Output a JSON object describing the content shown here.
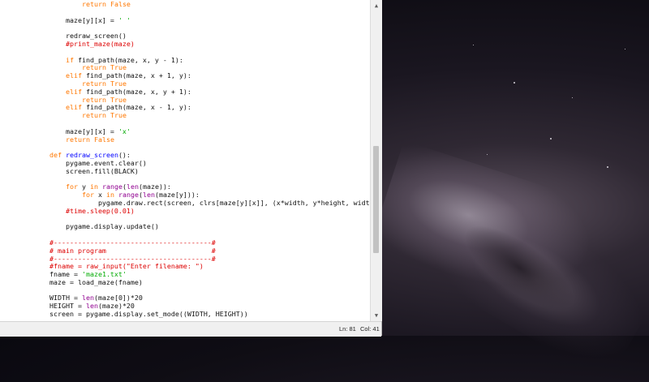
{
  "editor": {
    "lines": [
      [
        {
          "t": "        "
        },
        {
          "t": "return",
          "c": "kw"
        },
        {
          "t": " "
        },
        {
          "t": "False",
          "c": "kw"
        }
      ],
      [
        {
          "t": ""
        }
      ],
      [
        {
          "t": "    maze[y][x] = "
        },
        {
          "t": "' '",
          "c": "str"
        }
      ],
      [
        {
          "t": ""
        }
      ],
      [
        {
          "t": "    redraw_screen()"
        }
      ],
      [
        {
          "t": "    "
        },
        {
          "t": "#print_maze(maze)",
          "c": "cmt"
        }
      ],
      [
        {
          "t": ""
        }
      ],
      [
        {
          "t": "    "
        },
        {
          "t": "if",
          "c": "kw"
        },
        {
          "t": " find_path(maze, x, y - 1):"
        }
      ],
      [
        {
          "t": "        "
        },
        {
          "t": "return",
          "c": "kw"
        },
        {
          "t": " "
        },
        {
          "t": "True",
          "c": "kw"
        }
      ],
      [
        {
          "t": "    "
        },
        {
          "t": "elif",
          "c": "kw"
        },
        {
          "t": " find_path(maze, x + 1, y):"
        }
      ],
      [
        {
          "t": "        "
        },
        {
          "t": "return",
          "c": "kw"
        },
        {
          "t": " "
        },
        {
          "t": "True",
          "c": "kw"
        }
      ],
      [
        {
          "t": "    "
        },
        {
          "t": "elif",
          "c": "kw"
        },
        {
          "t": " find_path(maze, x, y + 1):"
        }
      ],
      [
        {
          "t": "        "
        },
        {
          "t": "return",
          "c": "kw"
        },
        {
          "t": " "
        },
        {
          "t": "True",
          "c": "kw"
        }
      ],
      [
        {
          "t": "    "
        },
        {
          "t": "elif",
          "c": "kw"
        },
        {
          "t": " find_path(maze, x - 1, y):"
        }
      ],
      [
        {
          "t": "        "
        },
        {
          "t": "return",
          "c": "kw"
        },
        {
          "t": " "
        },
        {
          "t": "True",
          "c": "kw"
        }
      ],
      [
        {
          "t": ""
        }
      ],
      [
        {
          "t": "    maze[y][x] = "
        },
        {
          "t": "'x'",
          "c": "str"
        }
      ],
      [
        {
          "t": "    "
        },
        {
          "t": "return",
          "c": "kw"
        },
        {
          "t": " "
        },
        {
          "t": "False",
          "c": "kw"
        }
      ],
      [
        {
          "t": ""
        }
      ],
      [
        {
          "t": "def",
          "c": "kw"
        },
        {
          "t": " "
        },
        {
          "t": "redraw_screen",
          "c": "def"
        },
        {
          "t": "():"
        }
      ],
      [
        {
          "t": "    pygame.event.clear()"
        }
      ],
      [
        {
          "t": "    screen.fill(BLACK)"
        }
      ],
      [
        {
          "t": ""
        }
      ],
      [
        {
          "t": "    "
        },
        {
          "t": "for",
          "c": "kw"
        },
        {
          "t": " y "
        },
        {
          "t": "in",
          "c": "kw"
        },
        {
          "t": " "
        },
        {
          "t": "range",
          "c": "bi"
        },
        {
          "t": "("
        },
        {
          "t": "len",
          "c": "bi"
        },
        {
          "t": "(maze)):"
        }
      ],
      [
        {
          "t": "        "
        },
        {
          "t": "for",
          "c": "kw"
        },
        {
          "t": " x "
        },
        {
          "t": "in",
          "c": "kw"
        },
        {
          "t": " "
        },
        {
          "t": "range",
          "c": "bi"
        },
        {
          "t": "("
        },
        {
          "t": "len",
          "c": "bi"
        },
        {
          "t": "(maze[y])):"
        }
      ],
      [
        {
          "t": "            pygame.draw.rect(screen, clrs[maze[y][x]], (x*width, y*height, width"
        }
      ],
      [
        {
          "t": "    "
        },
        {
          "t": "#time.sleep(0.01)",
          "c": "cmt"
        }
      ],
      [
        {
          "t": ""
        }
      ],
      [
        {
          "t": "    pygame.display.update()"
        }
      ],
      [
        {
          "t": ""
        }
      ],
      [
        {
          "t": "#---------------------------------------#",
          "c": "cmt"
        }
      ],
      [
        {
          "t": "# main program                          #",
          "c": "cmt"
        }
      ],
      [
        {
          "t": "#---------------------------------------#",
          "c": "cmt"
        }
      ],
      [
        {
          "t": "#fname = raw_input(\"Enter filename: \")",
          "c": "cmt"
        }
      ],
      [
        {
          "t": "fname = "
        },
        {
          "t": "'maze1.txt'",
          "c": "str"
        }
      ],
      [
        {
          "t": "maze = load_maze(fname)"
        }
      ],
      [
        {
          "t": ""
        }
      ],
      [
        {
          "t": "WIDTH = "
        },
        {
          "t": "len",
          "c": "bi"
        },
        {
          "t": "(maze[0])*20"
        }
      ],
      [
        {
          "t": "HEIGHT = "
        },
        {
          "t": "len",
          "c": "bi"
        },
        {
          "t": "(maze)*20"
        }
      ],
      [
        {
          "t": "screen = pygame.display.set_mode((WIDTH, HEIGHT))"
        }
      ]
    ]
  },
  "scrollbar": {
    "up_icon": "triangle-up-icon",
    "down_icon": "triangle-down-icon"
  },
  "status": {
    "line": "Ln: 81",
    "col": "Col: 41"
  }
}
